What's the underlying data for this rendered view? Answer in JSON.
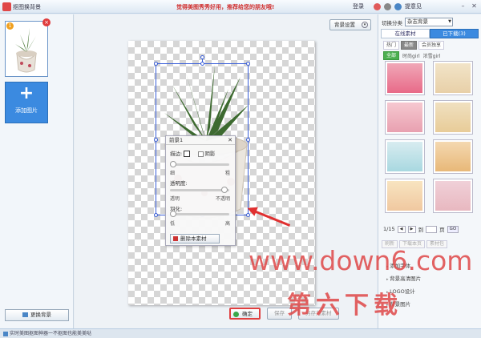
{
  "app": {
    "title": "抠图换背景",
    "slogan": "觉得美图秀秀好用，推荐给您的朋友哦!",
    "login": "登录",
    "feedback": "提意见"
  },
  "left": {
    "thumb_index": "1",
    "add_label": "添加图片",
    "change_bg_label": "更换背景"
  },
  "canvas": {
    "bg_settings_label": "背景设置"
  },
  "layer_panel": {
    "title": "前景1",
    "border_label": "描边:",
    "shadow_label": "阴影",
    "thin": "细",
    "thick": "粗",
    "opacity_label": "透明度:",
    "transparent": "透明",
    "opaque": "不透明",
    "feather_label": "羽化:",
    "low": "低",
    "high": "高",
    "delete_label": "删除本素材"
  },
  "bottom": {
    "ok": "确定",
    "save": "保存",
    "save_as": "另存为素材"
  },
  "right": {
    "category_label": "切换分类",
    "category_value": "杂志背景",
    "tab_online": "在线素材",
    "tab_downloaded": "已下载(3)",
    "filters": [
      "热门",
      "最新",
      "会员独享"
    ],
    "subfilters": [
      "全部",
      "时尚girl",
      "浓雪girl"
    ],
    "pager_text": "1/15",
    "goto_label": "到",
    "page_unit": "页",
    "go": "GO",
    "actions": [
      "刷新",
      "下载本页",
      "素材包"
    ],
    "links": [
      "添加字体",
      "背景高清图片",
      "LOGO设计",
      "背景图片"
    ]
  },
  "status": {
    "text": "实时美图抠图神器一不抠图也能美美哒"
  },
  "watermark": {
    "line1": "www.down6.com",
    "line2": "第六下载"
  },
  "colors": {
    "accent": "#3b8ae0",
    "selection": "#3a5fd8",
    "arrow": "#e03030"
  }
}
